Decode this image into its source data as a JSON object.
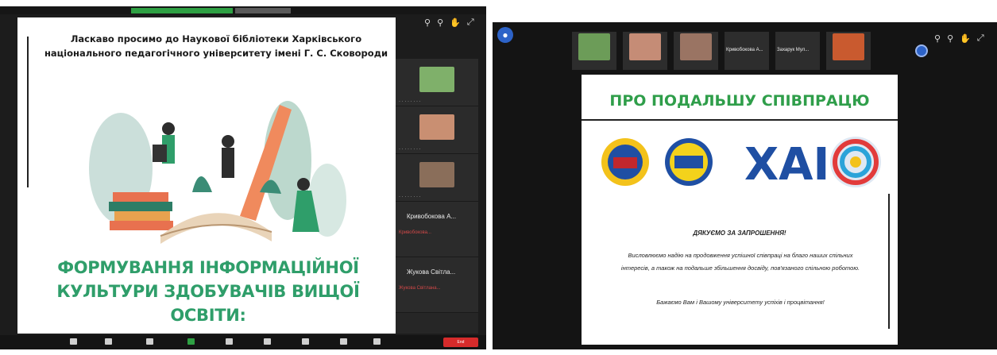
{
  "left": {
    "welcome_text": "Ласкаво просимо до Наукової бібліотеки Харківського національного педагогічного університету імені Г. С. Сковороди",
    "main_title": "ФОРМУВАННЯ ІНФОРМАЦІЙНОЇ КУЛЬТУРИ ЗДОБУВАЧІВ ВИЩОЇ ОСВІТИ:",
    "participants": [
      {
        "name": "Кривобокова А...",
        "status": "Кривобокова..."
      },
      {
        "name": "Жукова Світла...",
        "status": "Жукова Світлана..."
      }
    ],
    "end_button": "End"
  },
  "right": {
    "title": "ПРО ПОДАЛЬШУ СПІВПРАЦЮ",
    "logo_text": "ХАІ",
    "thanks": "ДЯКУЄМО ЗА ЗАПРОШЕННЯ!",
    "paragraph": "Висловлюємо надію на продовження успішної співпраці на благо наших спільних інтересів, а також на подальше збільшення досвіду, пов'язаного спільною роботою.",
    "closing": "Бажаємо Вам і Вашому університету успіхів і процвітання!",
    "strip_names": [
      "Кривобокова А...",
      "Захарук Мул..."
    ]
  },
  "colors": {
    "accent_green": "#2f9e6a",
    "zoom_bg": "#1c1c1c",
    "end_red": "#d62b2b",
    "zoom_blue": "#2d63c8"
  }
}
